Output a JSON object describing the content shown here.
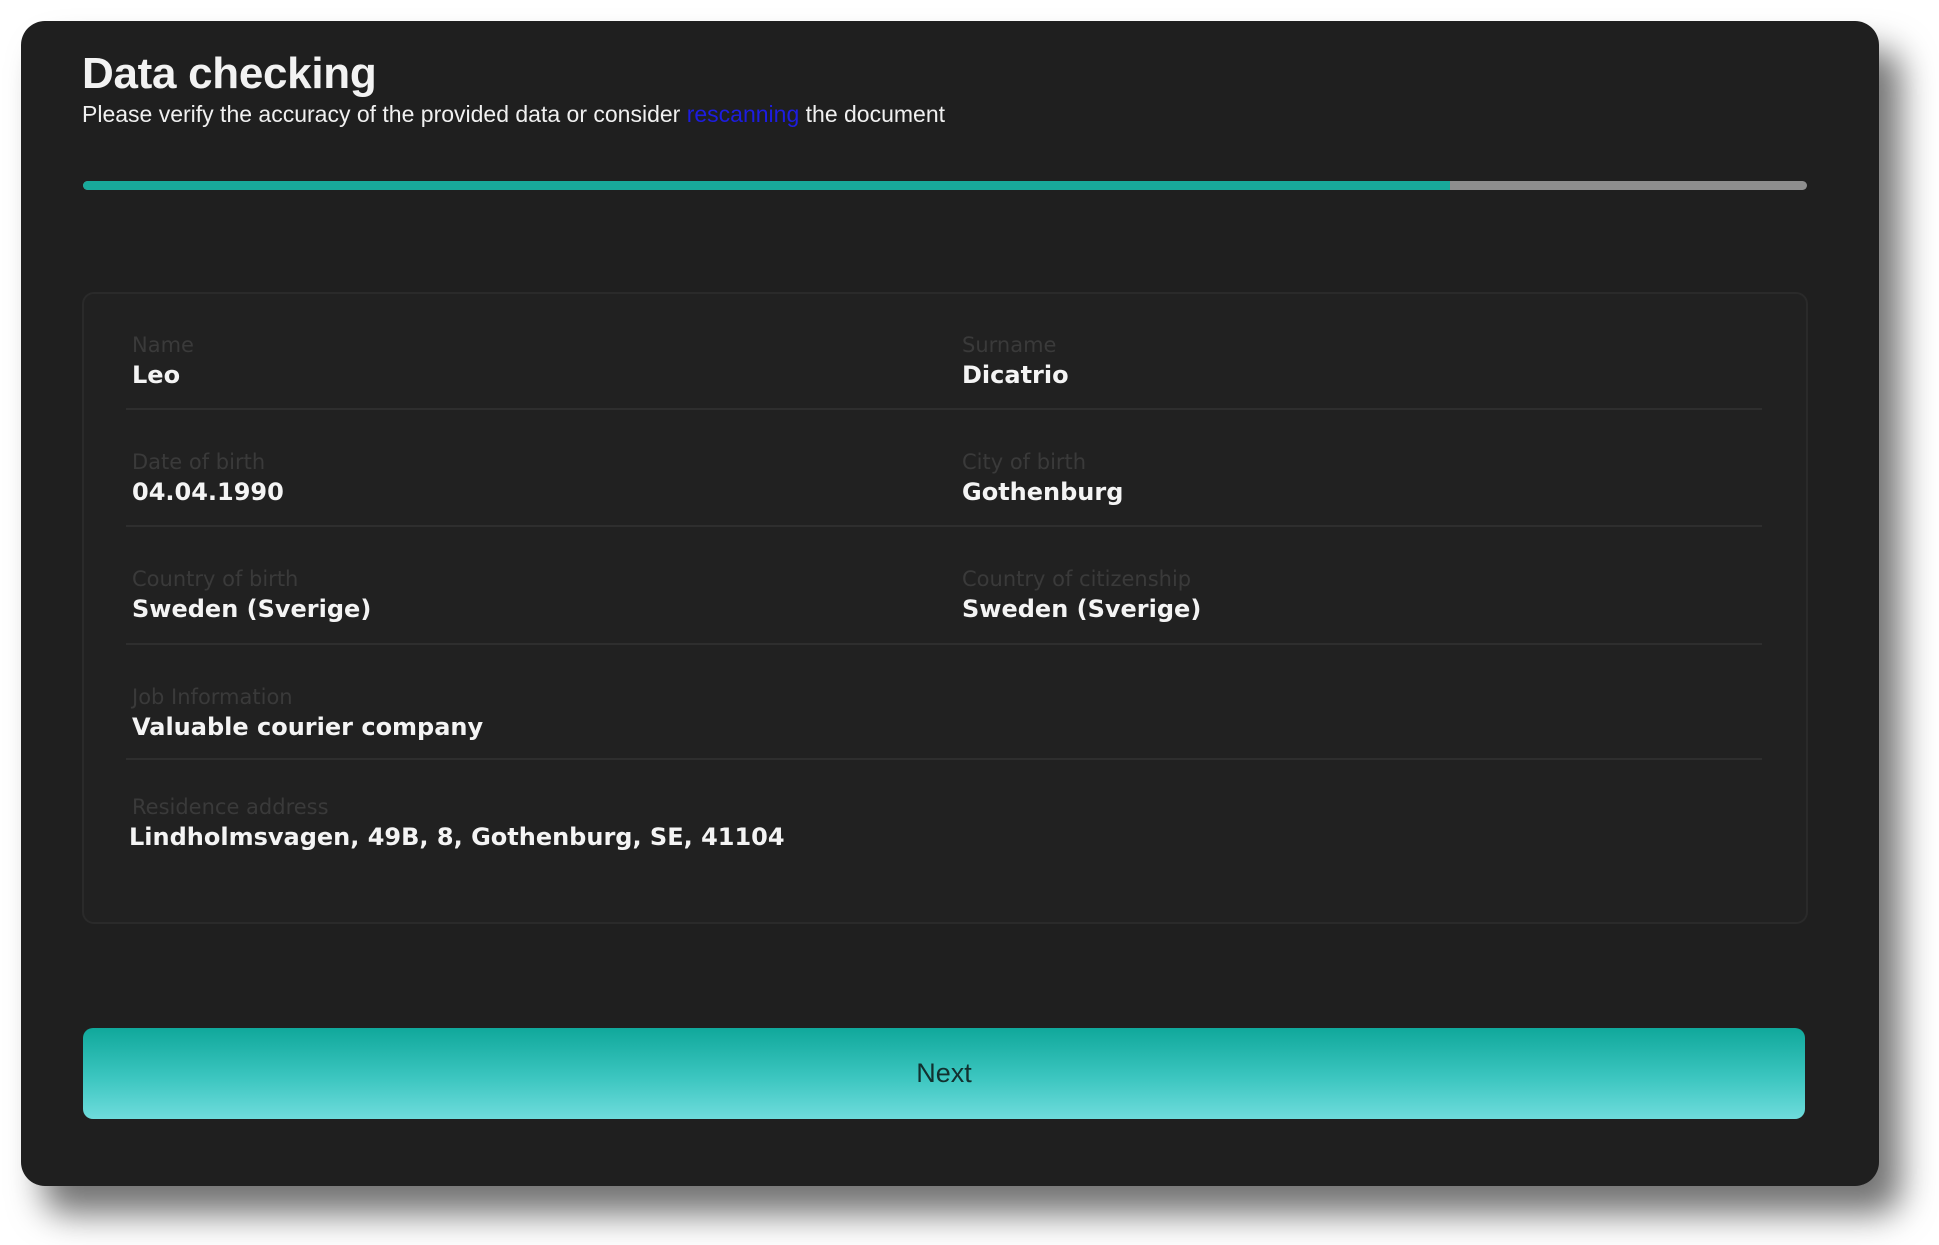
{
  "header": {
    "title": "Data checking",
    "subtitle_before": "Please verify the accuracy of the provided data or consider ",
    "subtitle_link": "rescanning",
    "subtitle_after": " the document"
  },
  "progress": {
    "fraction": 0.793,
    "fill_color": "#18a99a",
    "track_color": "#8e8e8e"
  },
  "fields": {
    "name": {
      "label": "Name",
      "value": "Leo"
    },
    "surname": {
      "label": "Surname",
      "value": "Dicatrio"
    },
    "date_of_birth": {
      "label": "Date of birth",
      "value": "04.04.1990"
    },
    "city_of_birth": {
      "label": "City of birth",
      "value": "Gothenburg"
    },
    "country_of_birth": {
      "label": "Country of birth",
      "value": "Sweden (Sverige)"
    },
    "country_of_citizenship": {
      "label": "Country of citizenship",
      "value": "Sweden (Sverige)"
    },
    "job_information": {
      "label": "Job Information",
      "value": "Valuable courier company"
    },
    "residence_address": {
      "label": "Residence address",
      "value": "Lindholmsvagen, 49B, 8, Gothenburg, SE, 41104"
    }
  },
  "actions": {
    "next_label": "Next"
  },
  "colors": {
    "background": "#1f1f1f",
    "accent": "#18a99a",
    "link": "#1d1de0"
  }
}
